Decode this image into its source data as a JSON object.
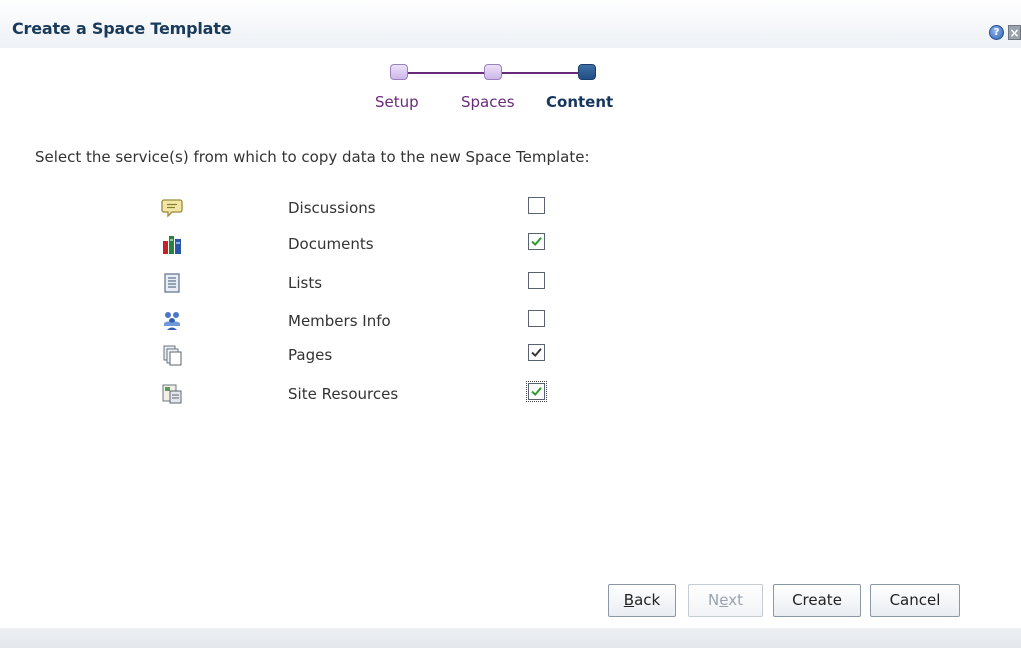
{
  "dialog": {
    "title": "Create a Space Template",
    "help_icon": "help-icon",
    "close_icon": "close-icon"
  },
  "train": {
    "steps": [
      {
        "label": "Setup",
        "state": "visited"
      },
      {
        "label": "Spaces",
        "state": "visited"
      },
      {
        "label": "Content",
        "state": "current"
      }
    ]
  },
  "instruction": "Select the service(s) from which to copy data to the new Space Template:",
  "services": [
    {
      "label": "Discussions",
      "icon": "discussions-icon",
      "checked": false
    },
    {
      "label": "Documents",
      "icon": "documents-icon",
      "checked": true
    },
    {
      "label": "Lists",
      "icon": "lists-icon",
      "checked": false
    },
    {
      "label": "Members Info",
      "icon": "members-info-icon",
      "checked": false
    },
    {
      "label": "Pages",
      "icon": "pages-icon",
      "checked": true
    },
    {
      "label": "Site Resources",
      "icon": "site-resources-icon",
      "checked": true
    }
  ],
  "buttons": {
    "back": {
      "pre": "",
      "key": "B",
      "post": "ack",
      "enabled": true
    },
    "next": {
      "pre": "N",
      "key": "e",
      "post": "xt",
      "enabled": false
    },
    "create": {
      "label": "Create",
      "enabled": true
    },
    "cancel": {
      "label": "Cancel",
      "enabled": true
    }
  },
  "colors": {
    "title": "#1a3a5a",
    "train_visited": "#6a2a7a",
    "train_current": "#16365e",
    "check_green": "#2e9b2e",
    "check_dark": "#3a3a3a"
  }
}
